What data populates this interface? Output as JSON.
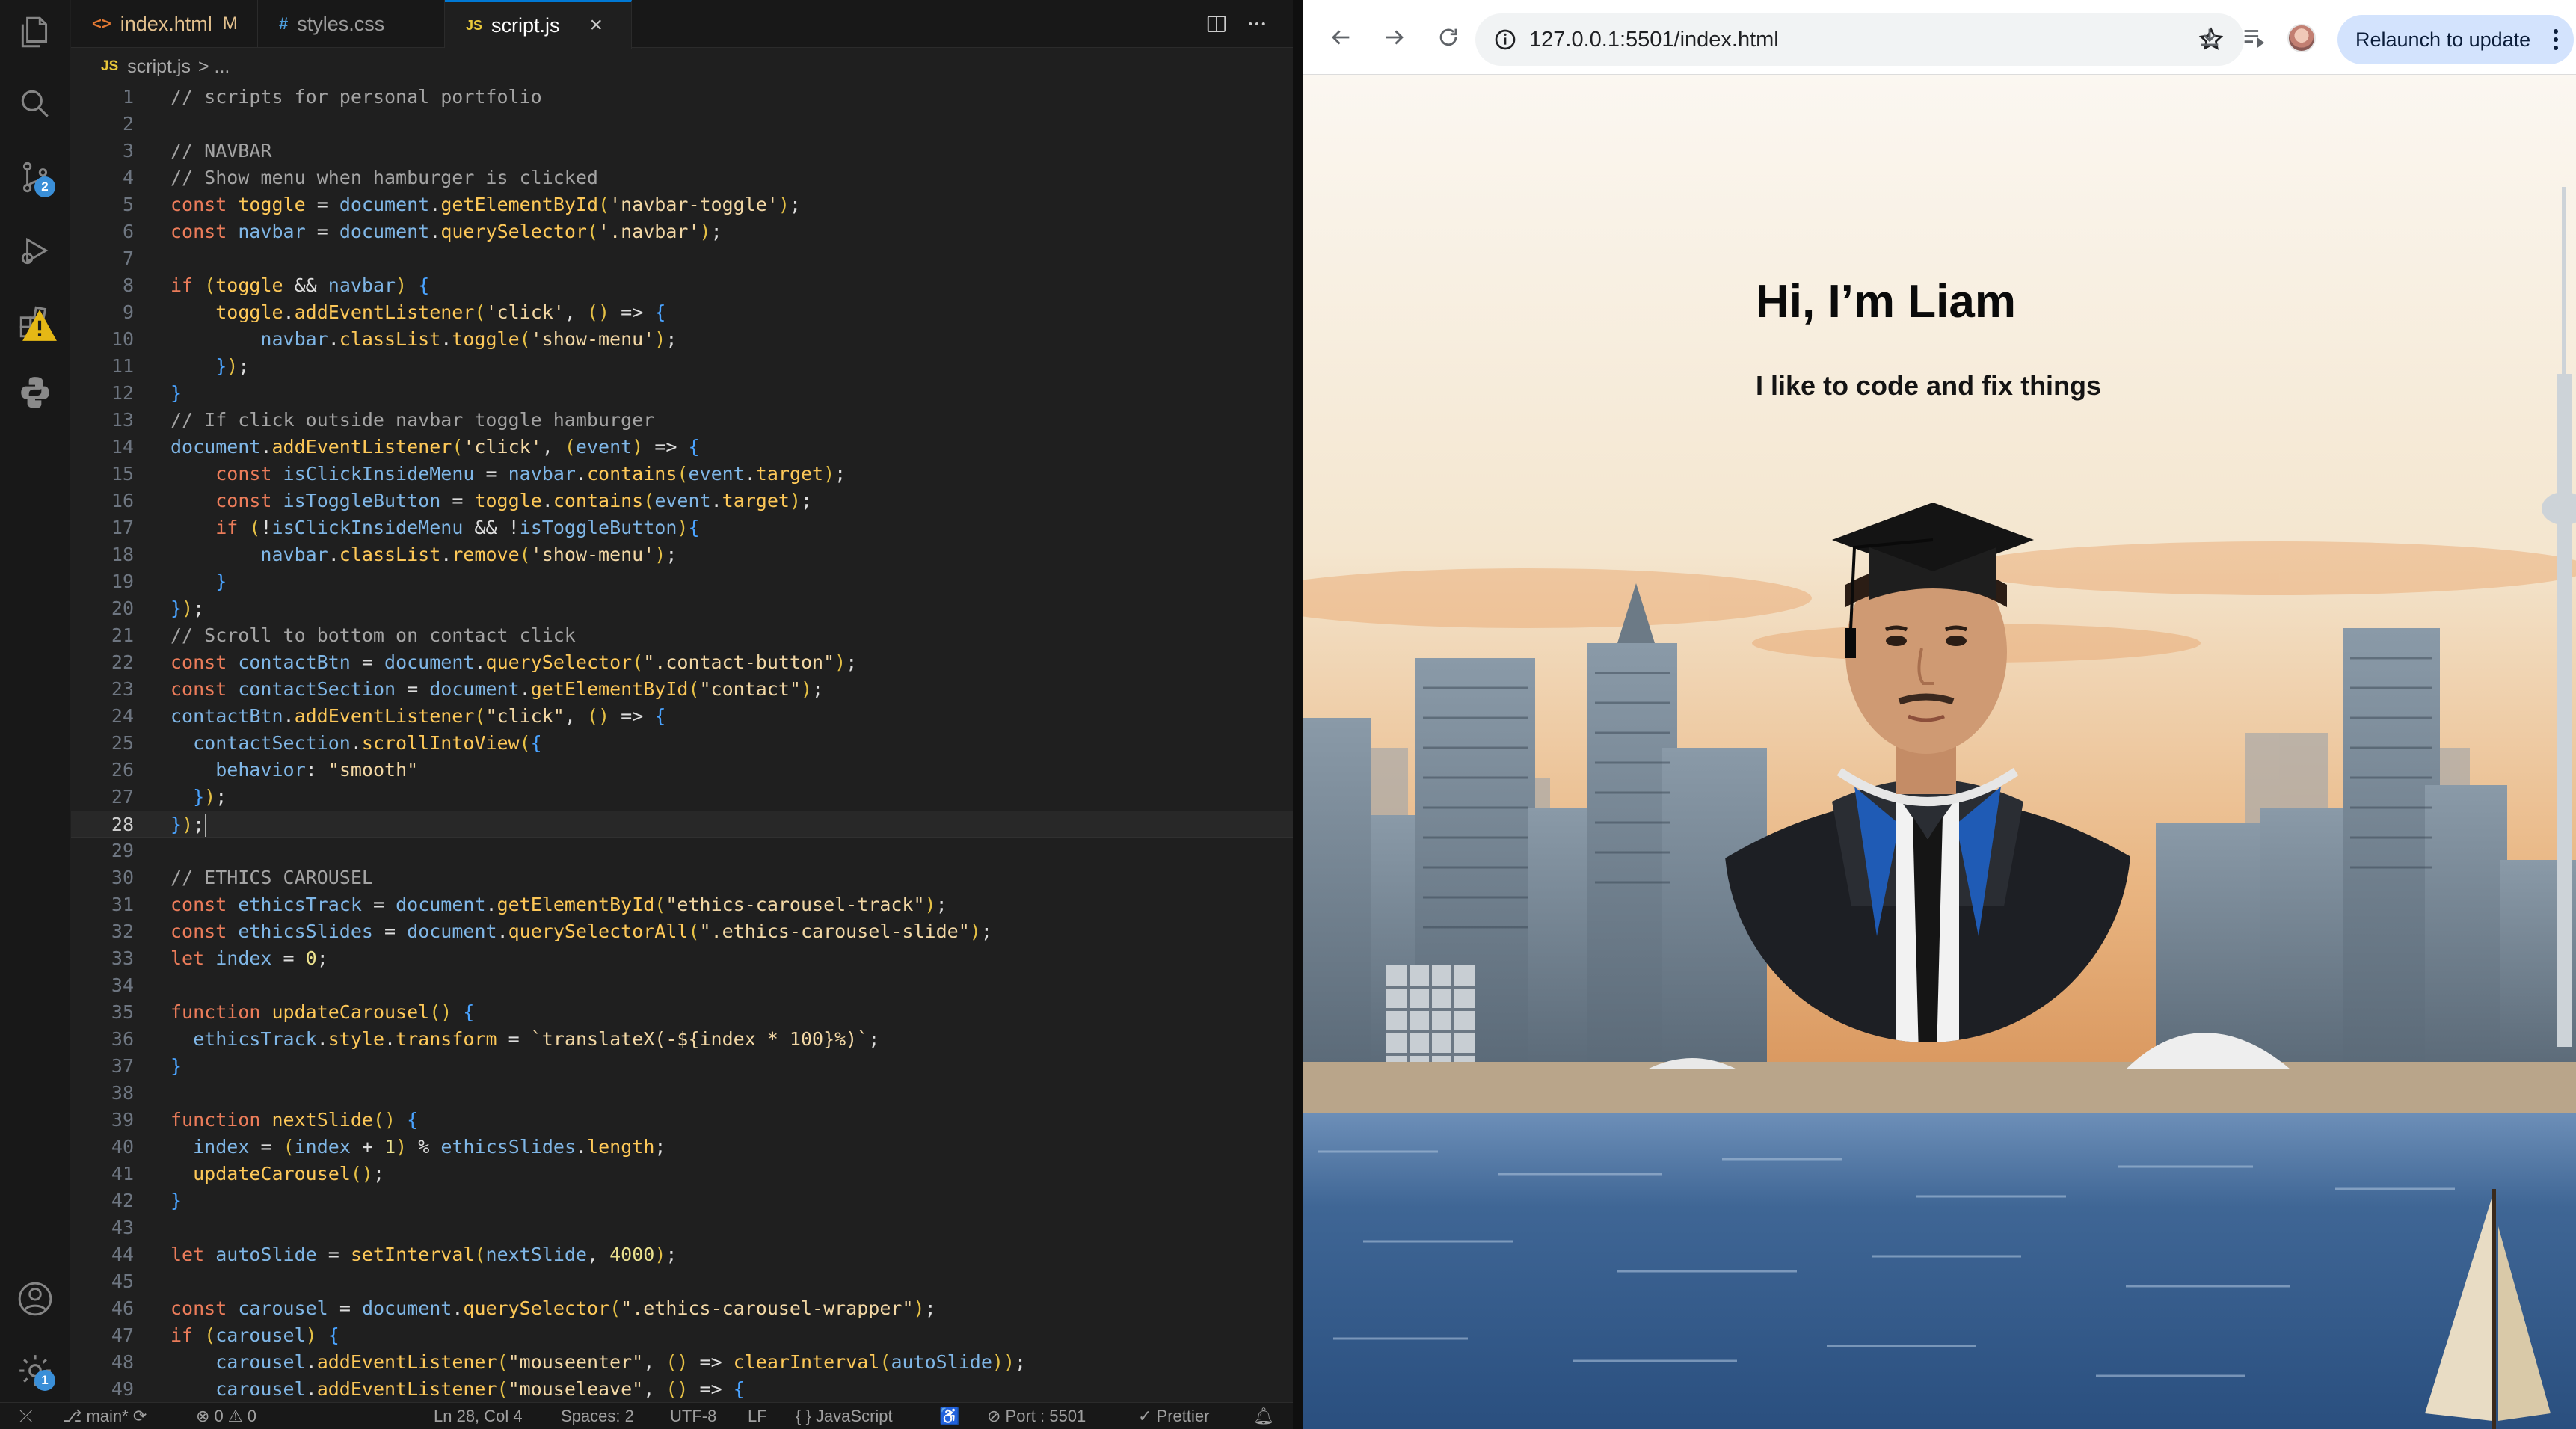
{
  "vscode": {
    "tabs": [
      {
        "label": "index.html",
        "icon": "<>",
        "modified": "M",
        "active": false
      },
      {
        "label": "styles.css",
        "icon": "#",
        "modified": "",
        "active": false
      },
      {
        "label": "script.js",
        "icon": "JS",
        "modified": "",
        "active": true,
        "close": "×"
      }
    ],
    "breadcrumb": {
      "file": "script.js",
      "rest": "> ..."
    },
    "code_lines": [
      "// scripts for personal portfolio",
      "",
      "// NAVBAR",
      "// Show menu when hamburger is clicked",
      "const toggle = document.getElementById('navbar-toggle');",
      "const navbar = document.querySelector('.navbar');",
      "",
      "if (toggle && navbar) {",
      "    toggle.addEventListener('click', () => {",
      "        navbar.classList.toggle('show-menu');",
      "    });",
      "}",
      "// If click outside navbar toggle hamburger",
      "document.addEventListener('click', (event) => {",
      "    const isClickInsideMenu = navbar.contains(event.target);",
      "    const isToggleButton = toggle.contains(event.target);",
      "    if (!isClickInsideMenu && !isToggleButton){",
      "        navbar.classList.remove('show-menu');",
      "    }",
      "});",
      "// Scroll to bottom on contact click",
      "const contactBtn = document.querySelector(\".contact-button\");",
      "const contactSection = document.getElementById(\"contact\");",
      "contactBtn.addEventListener(\"click\", () => {",
      "  contactSection.scrollIntoView({",
      "    behavior: \"smooth\"",
      "  });",
      "});",
      "",
      "// ETHICS CAROUSEL",
      "const ethicsTrack = document.getElementById(\"ethics-carousel-track\");",
      "const ethicsSlides = document.querySelectorAll(\".ethics-carousel-slide\");",
      "let index = 0;",
      "",
      "function updateCarousel() {",
      "  ethicsTrack.style.transform = `translateX(-${index * 100}%)`;",
      "}",
      "",
      "function nextSlide() {",
      "  index = (index + 1) % ethicsSlides.length;",
      "  updateCarousel();",
      "}",
      "",
      "let autoSlide = setInterval(nextSlide, 4000);",
      "",
      "const carousel = document.querySelector(\".ethics-carousel-wrapper\");",
      "if (carousel) {",
      "    carousel.addEventListener(\"mouseenter\", () => clearInterval(autoSlide));",
      "    carousel.addEventListener(\"mouseleave\", () => {"
    ],
    "current_line": 28,
    "status": {
      "branch": "main*",
      "problems": "⊗ 0 ⚠ 0",
      "position": "Ln 28, Col 4",
      "spaces": "Spaces: 2",
      "encoding": "UTF-8",
      "eol": "LF",
      "language": "{ } JavaScript",
      "port": "Port : 5501",
      "prettier": "✓ Prettier"
    },
    "badges": {
      "source_control": "2",
      "settings": "1"
    },
    "colors": {
      "accent": "#0078d4",
      "badge": "#3a8fd8",
      "warning": "#e2c08d"
    }
  },
  "browser": {
    "url": "127.0.0.1:5501/index.html",
    "relaunch_label": "Relaunch to update",
    "page": {
      "title": "Hi, I’m Liam",
      "subtitle": "I like to code and fix things"
    },
    "colors": {
      "relaunch_bg": "#d3e3fd",
      "omnibox_bg": "#f1f3f4"
    }
  }
}
